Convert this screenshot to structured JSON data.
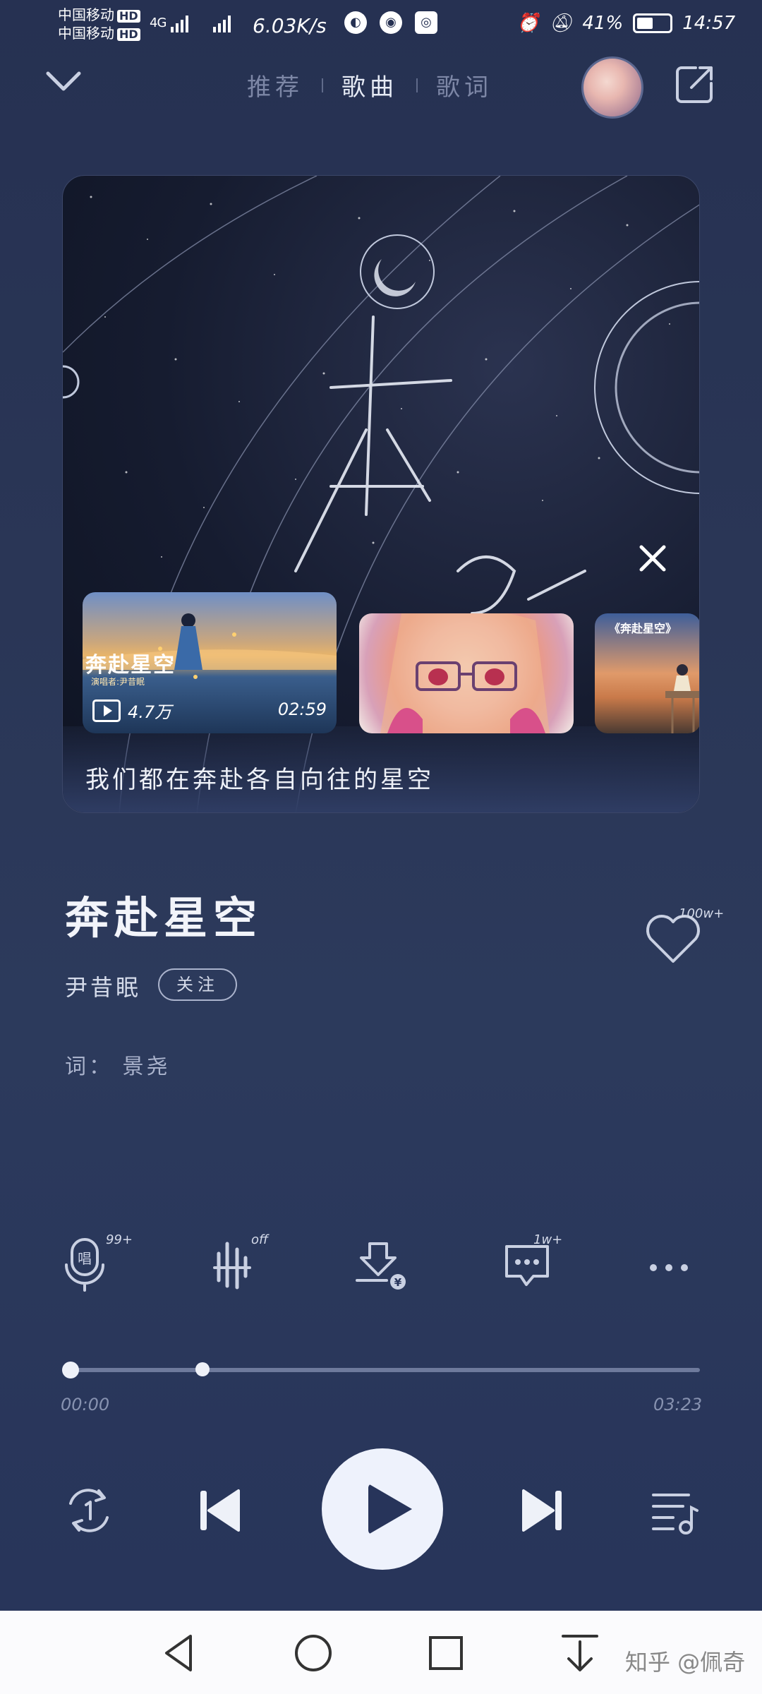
{
  "status_bar": {
    "carrier1": "中国移动",
    "carrier2": "中国移动",
    "hd": "HD",
    "signal": "4G",
    "speed": "6.03K/s",
    "battery": "41%",
    "time": "14:57"
  },
  "header": {
    "tabs": [
      {
        "label": "推荐",
        "active": false
      },
      {
        "label": "歌曲",
        "active": true
      },
      {
        "label": "歌词",
        "active": false
      }
    ]
  },
  "card": {
    "video1": {
      "title": "奔赴星空",
      "subtitle": "演唱者:尹昔眠",
      "plays": "4.7万",
      "duration": "02:59"
    },
    "video3": {
      "title": "《奔赴星空》"
    },
    "caption": "我们都在奔赴各自向往的星空"
  },
  "song": {
    "title": "奔赴星空",
    "artist": "尹昔眠",
    "follow_label": "关注",
    "lyricist": "词： 景尧",
    "like_count": "100w+"
  },
  "actions": {
    "sing_badge": "99+",
    "effect_badge": "off",
    "comment_badge": "1w+"
  },
  "progress": {
    "current": "00:00",
    "total": "03:23",
    "played_fraction": 0.0,
    "buffered_fraction": 0.22
  },
  "watermark": "知乎 @佩奇",
  "colors": {
    "background": "#2a3656",
    "accent": "#eef2fc",
    "muted": "#8792b0"
  }
}
